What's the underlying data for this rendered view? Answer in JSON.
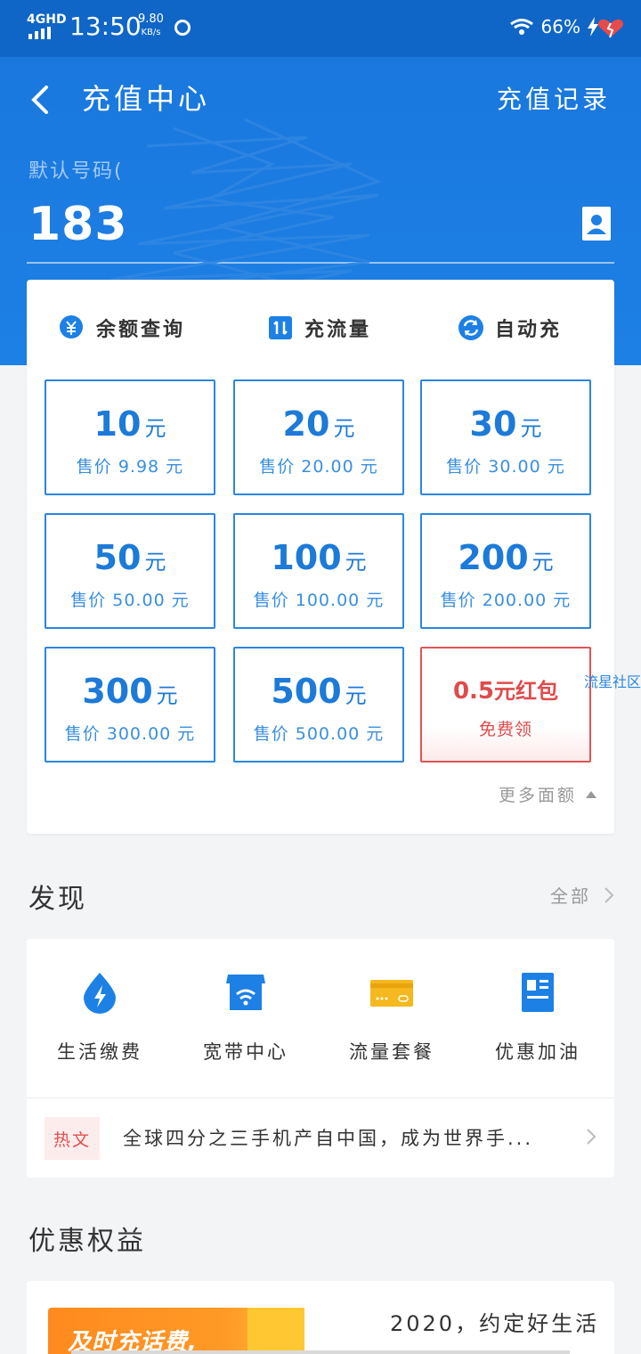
{
  "status_bar": {
    "network": "4GHD",
    "time": "13:50",
    "speed_value": "9.80",
    "speed_unit": "KB/s",
    "battery": "66%"
  },
  "header": {
    "title": "充值中心",
    "records_label": "充值记录",
    "phone_label": "默认号码(",
    "phone_number": "183"
  },
  "quick_actions": [
    {
      "label": "余额查询",
      "icon": "yuan-search-icon"
    },
    {
      "label": "充流量",
      "icon": "data-icon"
    },
    {
      "label": "自动充",
      "icon": "refresh-icon"
    }
  ],
  "amounts": [
    {
      "value": "10",
      "unit": "元",
      "price": "售价 9.98 元"
    },
    {
      "value": "20",
      "unit": "元",
      "price": "售价 20.00 元"
    },
    {
      "value": "30",
      "unit": "元",
      "price": "售价 30.00 元"
    },
    {
      "value": "50",
      "unit": "元",
      "price": "售价 50.00 元"
    },
    {
      "value": "100",
      "unit": "元",
      "price": "售价 100.00 元"
    },
    {
      "value": "200",
      "unit": "元",
      "price": "售价 200.00 元"
    },
    {
      "value": "300",
      "unit": "元",
      "price": "售价 300.00 元"
    },
    {
      "value": "500",
      "unit": "元",
      "price": "售价 500.00 元"
    }
  ],
  "red_packet": {
    "value": "0.5",
    "text": "元红包",
    "sub": "免费领"
  },
  "more_label": "更多面额",
  "side_tag": "流星社区",
  "discover": {
    "title": "发现",
    "all_label": "全部",
    "items": [
      {
        "label": "生活缴费",
        "icon": "lightning-drop-icon"
      },
      {
        "label": "宽带中心",
        "icon": "wifi-store-icon"
      },
      {
        "label": "流量套餐",
        "icon": "card-icon"
      },
      {
        "label": "优惠加油",
        "icon": "fuel-icon"
      }
    ],
    "news_tag": "热文",
    "news_text": "全球四分之三手机产自中国，成为世界手..."
  },
  "benefits": {
    "title": "优惠权益",
    "banner_text": "及时充话费,",
    "promo_text": "2020，约定好生活"
  },
  "colors": {
    "primary": "#1d80e5",
    "accent_red": "#e05454"
  }
}
